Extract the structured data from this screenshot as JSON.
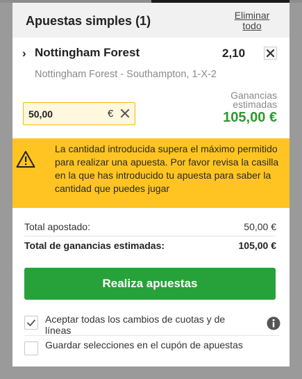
{
  "header": {
    "title": "Apuestas simples (1)",
    "clear_all": "Eliminar todo"
  },
  "bet": {
    "selection": "Nottingham Forest",
    "odds": "2,10",
    "market": "Nottingham Forest - Southampton, 1-X-2",
    "stake": "50,00",
    "currency": "€",
    "estimated_label": "Ganancias estimadas",
    "estimated_value": "105,00 €"
  },
  "warning": {
    "text": "La cantidad introducida supera el máximo permitido para realizar una apuesta. Por favor revisa la casilla en la que has introducido tu apuesta para saber la cantidad que puedes jugar"
  },
  "summary": {
    "total_staked_label": "Total apostado:",
    "total_staked_value": "50,00 €",
    "total_winnings_label": "Total de ganancias estimadas:",
    "total_winnings_value": "105,00 €"
  },
  "place_bet_label": "Realiza apuestas",
  "options": {
    "accept_changes_label": "Aceptar todas los cambios de cuotas y de líneas",
    "accept_changes_checked": true,
    "save_selections_label": "Guardar selecciones en el cupón de apuestas",
    "save_selections_checked": false
  },
  "colors": {
    "accent_green": "#27a13a",
    "win_green": "#2e9a2e",
    "warning_yellow": "#ffc421"
  }
}
